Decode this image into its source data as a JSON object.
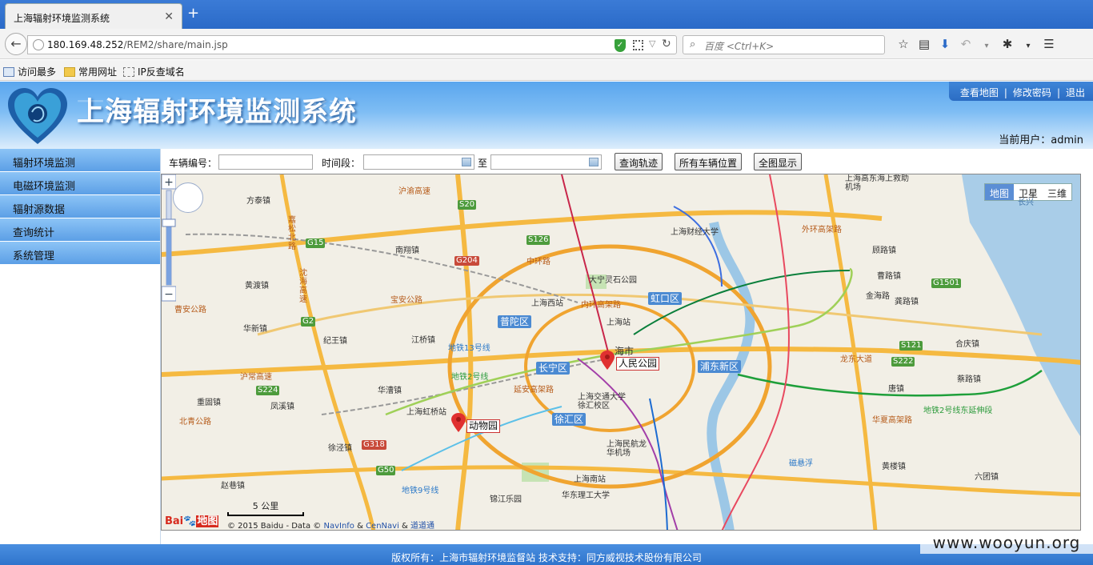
{
  "browser": {
    "tab_title": "上海辐射环境监测系统",
    "url_host": "180.169.48.252",
    "url_path": "/REM2/share/main.jsp",
    "search_placeholder": "百度 <Ctrl+K>",
    "bookmarks": [
      "访问最多",
      "常用网址",
      "IP反查域名"
    ]
  },
  "header": {
    "title": "上海辐射环境监测系统",
    "links": [
      "查看地图",
      "修改密码",
      "退出"
    ],
    "current_user": "当前用户：admin"
  },
  "sidebar": {
    "items": [
      "辐射环境监测",
      "电磁环境监测",
      "辐射源数据",
      "查询统计",
      "系统管理"
    ]
  },
  "toolbar": {
    "vehicle_label": "车辆编号：",
    "period_label": "时间段：",
    "to_label": "至",
    "btn_track": "查询轨迹",
    "btn_all": "所有车辆位置",
    "btn_full": "全图显示"
  },
  "map": {
    "types": [
      "地图",
      "卫星",
      "三维"
    ],
    "active_type": "地图",
    "markers": [
      "人民公园",
      "动物园"
    ],
    "city_label": "海市",
    "districts": [
      "虹口区",
      "普陀区",
      "长宁区",
      "浦东新区",
      "徐汇区"
    ],
    "places": [
      "方泰镇",
      "南翔镇",
      "黄渡镇",
      "华新镇",
      "纪王镇",
      "江桥镇",
      "重固镇",
      "凤溪镇",
      "华漕镇",
      "上海虹桥站",
      "徐泾镇",
      "赵巷镇",
      "上海西站",
      "大宁灵石公园",
      "上海站",
      "上海财经大学",
      "上海交通大学徐汇校区",
      "上海民航龙华机场",
      "上海南站",
      "华东理工大学",
      "锦江乐园",
      "上海高东海上救助机场",
      "顾路镇",
      "曹路镇",
      "金海路",
      "龚路镇",
      "合庆镇",
      "唐镇",
      "蔡路镇",
      "黄楼镇",
      "六团镇",
      "北青公路",
      "沪常高速",
      "宝安公路",
      "嘉松北路",
      "沈海高速",
      "曹安公路",
      "中环路",
      "外环高架路",
      "华夏高架路",
      "龙东大道",
      "延安高架路",
      "内环高架路",
      "沪渝高速",
      "地铁9号线",
      "地铁13号线",
      "地铁2号线",
      "地铁2号线东延伸段",
      "磁悬浮",
      "长兴"
    ],
    "roads": [
      "S20",
      "G15",
      "G2",
      "S224",
      "G318",
      "G50",
      "S126",
      "G204",
      "G1501",
      "S121",
      "S222"
    ],
    "scale": "5 公里",
    "copyright_prefix": "© 2015 Baidu - Data ©",
    "copyright_links": [
      "NavInfo",
      "CenNavi",
      "道道通"
    ],
    "baidu_logo": "Bai地图"
  },
  "footer": {
    "text": "版权所有：上海市辐射环境监督站   技术支持：同方威视技术股份有限公司"
  },
  "watermark": "www.wooyun.org",
  "colors": {
    "header_top": "#5aa6ee",
    "sidebar": "#8cc4f6",
    "footer": "#2f74cc",
    "map_bg": "#f2efe6",
    "marker": "#e03030"
  }
}
